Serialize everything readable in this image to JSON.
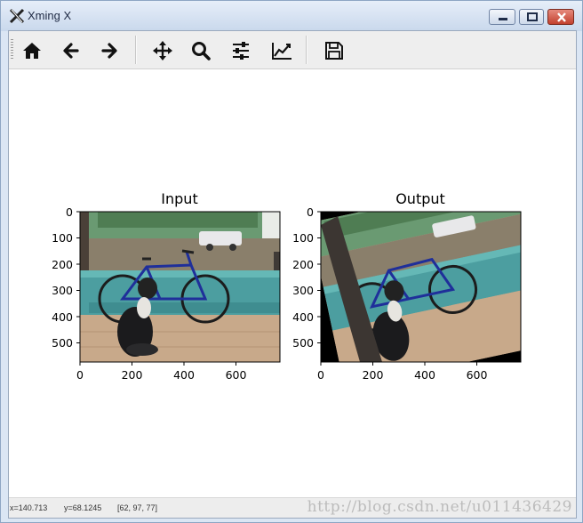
{
  "window": {
    "title": "Xming X"
  },
  "toolbar": {
    "buttons": [
      {
        "name": "home-button",
        "icon": "home-icon"
      },
      {
        "name": "back-button",
        "icon": "arrow-left-icon"
      },
      {
        "name": "forward-button",
        "icon": "arrow-right-icon"
      },
      {
        "name": "pan-button",
        "icon": "move-icon"
      },
      {
        "name": "zoom-button",
        "icon": "zoom-icon"
      },
      {
        "name": "subplots-button",
        "icon": "sliders-icon"
      },
      {
        "name": "customize-button",
        "icon": "line-chart-icon"
      },
      {
        "name": "save-button",
        "icon": "save-icon"
      }
    ]
  },
  "figure": {
    "axes": [
      {
        "title": "Input",
        "xticks": [
          "0",
          "200",
          "400",
          "600"
        ],
        "yticks": [
          "0",
          "100",
          "200",
          "300",
          "400",
          "500"
        ]
      },
      {
        "title": "Output",
        "xticks": [
          "0",
          "200",
          "400",
          "600"
        ],
        "yticks": [
          "0",
          "100",
          "200",
          "300",
          "400",
          "500"
        ]
      }
    ]
  },
  "status": {
    "x": "x=140.713",
    "y": "y=68.1245",
    "rgb": "[62, 97, 77]",
    "watermark": "http://blog.csdn.net/u011436429"
  }
}
